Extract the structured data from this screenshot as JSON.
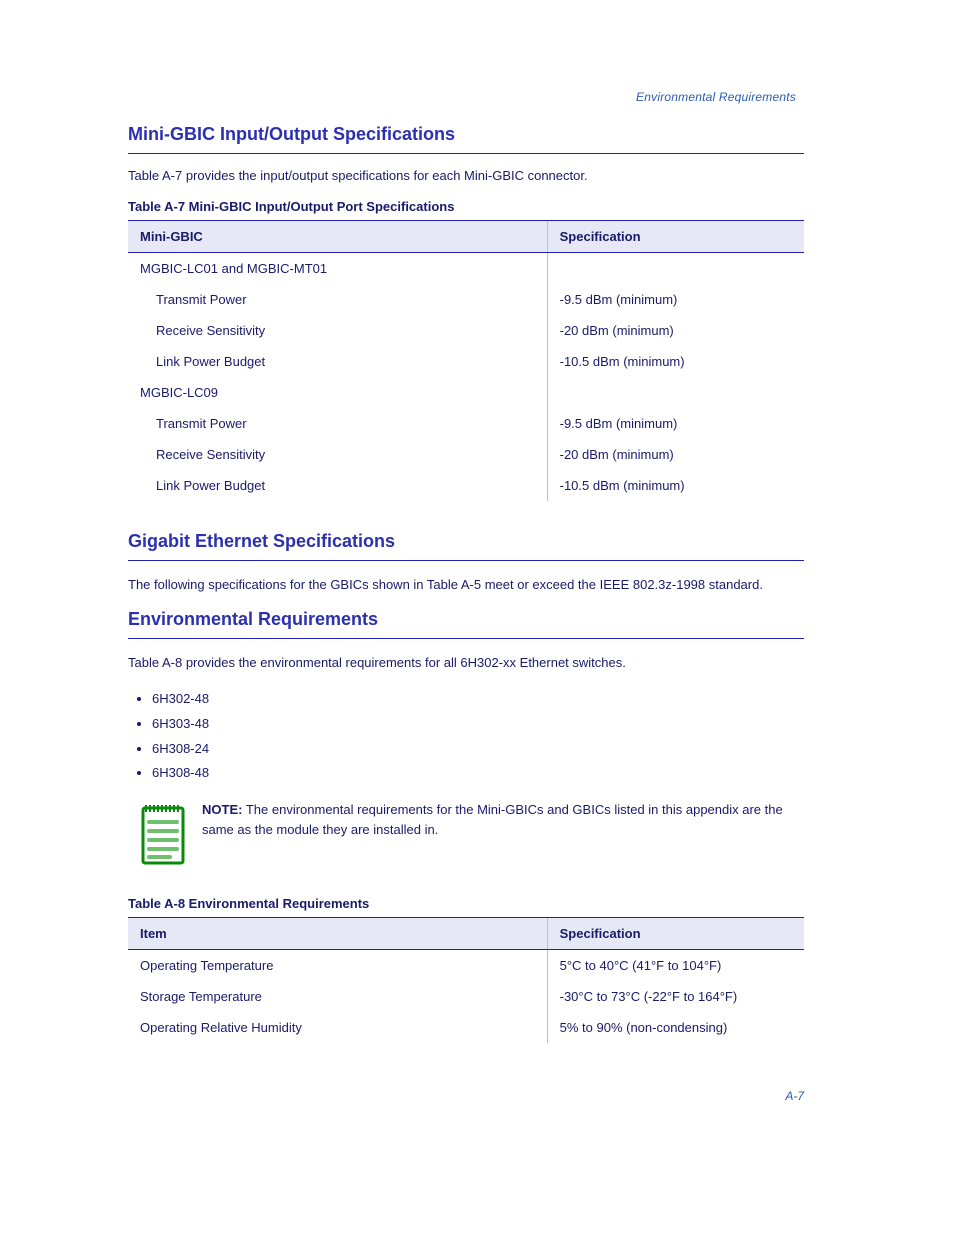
{
  "breadcrumb": "Environmental Requirements",
  "sections": {
    "connector_spec": {
      "title": "Mini-GBIC Input/Output Specifications",
      "intro": "Table A-7 provides the input/output specifications for each Mini-GBIC connector.",
      "table_caption": "Table A-7   Mini-GBIC Input/Output Port Specifications",
      "headers": [
        "Mini-GBIC",
        "Specification"
      ],
      "rows": [
        {
          "name": "MGBIC-LC01 and MGBIC-MT01",
          "items": [
            {
              "label": "Transmit Power",
              "value": "-9.5 dBm (minimum)"
            },
            {
              "label": "Receive Sensitivity",
              "value": "-20 dBm (minimum)"
            },
            {
              "label": "Link Power Budget",
              "value": "-10.5 dBm (minimum)"
            }
          ]
        },
        {
          "name": "MGBIC-LC09",
          "items": [
            {
              "label": "Transmit Power",
              "value": "-9.5 dBm (minimum)"
            },
            {
              "label": "Receive Sensitivity",
              "value": "-20 dBm (minimum)"
            },
            {
              "label": "Link Power Budget",
              "value": "-10.5 dBm (minimum)"
            }
          ]
        }
      ]
    },
    "gbic_modules": {
      "title": "Gigabit Ethernet Specifications",
      "body": "The following specifications for the GBICs shown in Table A-5 meet or exceed the IEEE 802.3z-1998 standard."
    },
    "env": {
      "title": "Environmental Requirements",
      "body_1": "Table A-8 provides the environmental requirements for all 6H302-xx Ethernet switches.",
      "bullets": [
        "6H302-48",
        "6H303-48",
        "6H308-24",
        "6H308-48"
      ],
      "note": {
        "label": "NOTE:",
        "text": "The environmental requirements for the Mini-GBICs and GBICs listed in this appendix are the same as the module they are installed in."
      },
      "table_caption": "Table A-8   Environmental Requirements",
      "headers": [
        "Item",
        "Specification"
      ],
      "rows": [
        {
          "item": "Operating Temperature",
          "value": "5°C to 40°C (41°F to 104°F)"
        },
        {
          "item": "Storage Temperature",
          "value": "-30°C to 73°C (-22°F to 164°F)"
        },
        {
          "item": "Operating Relative Humidity",
          "value": "5% to 90% (non-condensing)"
        }
      ]
    }
  },
  "page_number": "A-7"
}
